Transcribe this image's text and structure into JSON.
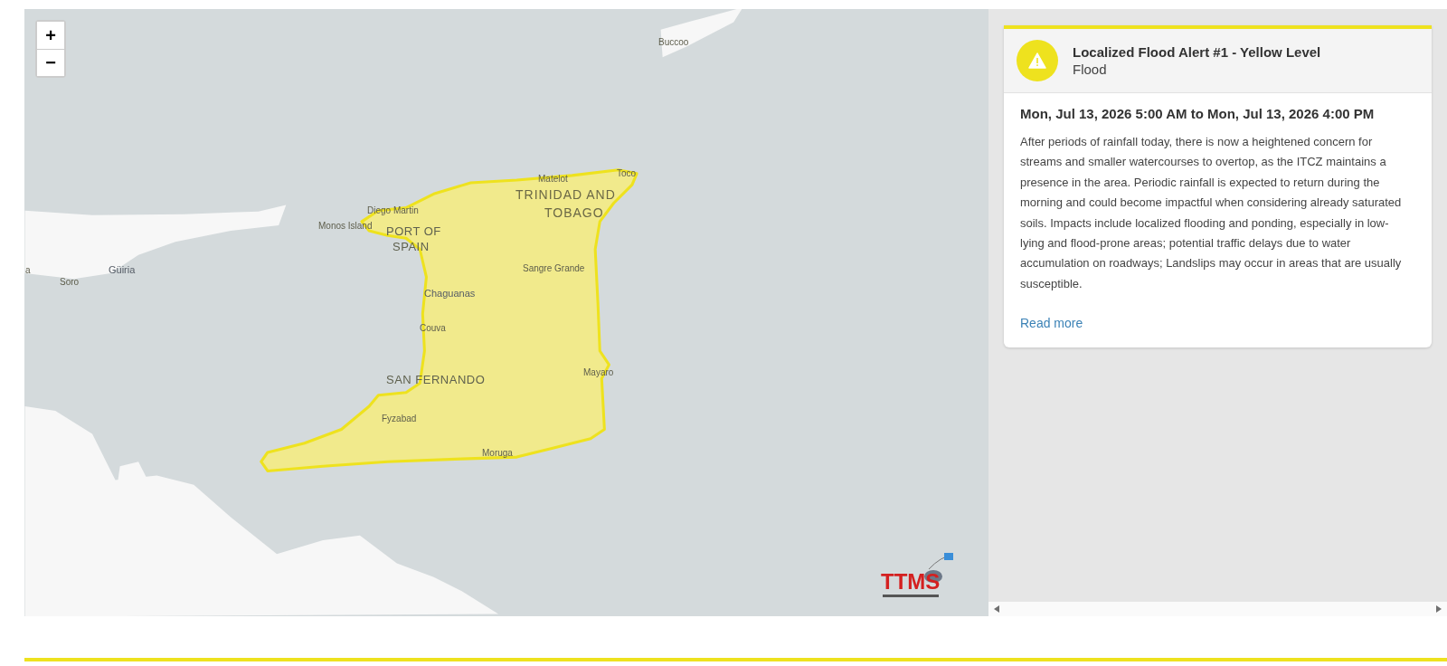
{
  "map": {
    "zoom_in": "+",
    "zoom_out": "−",
    "labels": [
      {
        "text": "Buccoo",
        "kind": "place"
      },
      {
        "text": "Matelot",
        "kind": "place"
      },
      {
        "text": "Toco",
        "kind": "place"
      },
      {
        "text": "TRINIDAD AND",
        "kind": "country"
      },
      {
        "text": "Diego Martin",
        "kind": "place"
      },
      {
        "text": "TOBAGO",
        "kind": "country"
      },
      {
        "text": "Monos Island",
        "kind": "place"
      },
      {
        "text": "PORT OF",
        "kind": "city"
      },
      {
        "text": "SPAIN",
        "kind": "city"
      },
      {
        "text": "a",
        "kind": "place"
      },
      {
        "text": "Güiria",
        "kind": "town"
      },
      {
        "text": "Sangre Grande",
        "kind": "place"
      },
      {
        "text": "Soro",
        "kind": "place"
      },
      {
        "text": "Chaguanas",
        "kind": "town"
      },
      {
        "text": "Couva",
        "kind": "place"
      },
      {
        "text": "SAN FERNANDO",
        "kind": "city"
      },
      {
        "text": "Mayaro",
        "kind": "place"
      },
      {
        "text": "Fyzabad",
        "kind": "place"
      },
      {
        "text": "Moruga",
        "kind": "place"
      }
    ],
    "logo": {
      "text": "TTMS"
    }
  },
  "alert": {
    "title": "Localized Flood Alert #1 - Yellow Level",
    "category": "Flood",
    "color": "#eee21e",
    "period": "Mon, Jul 13, 2026 5:00 AM to Mon, Jul 13, 2026 4:00 PM",
    "description": "After periods of rainfall today, there is now a heightened concern for streams and smaller watercourses to overtop, as the ITCZ maintains a presence in the area. Periodic rainfall is expected to return during the morning and could become impactful when considering already saturated soils. Impacts include localized flooding and ponding, especially in low- lying and flood-prone areas; potential traffic delays due to water accumulation on roadways; Landslips may occur in areas that are usually susceptible.",
    "read_more": "Read more"
  }
}
